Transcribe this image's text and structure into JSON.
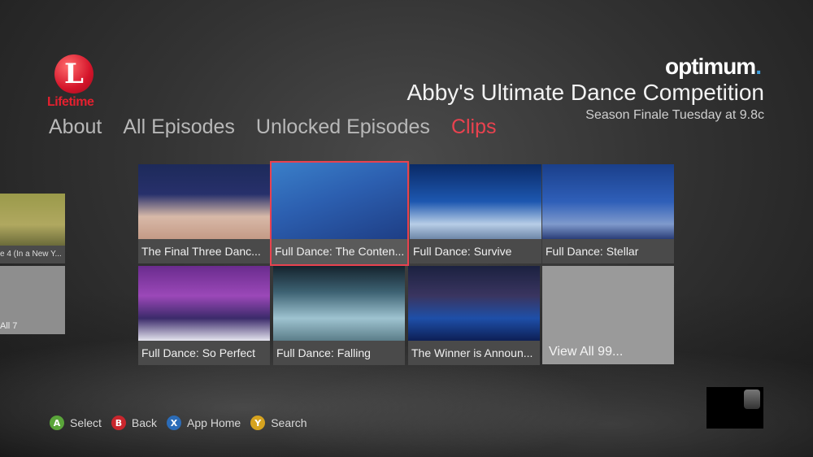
{
  "brand_logo": {
    "symbol": "L",
    "name": "Lifetime"
  },
  "nav": {
    "tabs": [
      {
        "label": "About",
        "active": false
      },
      {
        "label": "All Episodes",
        "active": false
      },
      {
        "label": "Unlocked Episodes",
        "active": false
      },
      {
        "label": "Clips",
        "active": true
      }
    ]
  },
  "header": {
    "provider": "optimum",
    "provider_dot": ".",
    "title": "Abby's Ultimate Dance Competition",
    "subtitle": "Season Finale Tuesday at 9.8c"
  },
  "left_partial": {
    "caption": "e 4 (In a New Y...",
    "view_all": "All 7"
  },
  "clips": [
    {
      "caption": "The Final Three Danc...",
      "selected": false
    },
    {
      "caption": "Full Dance: The Conten...",
      "selected": true
    },
    {
      "caption": "Full Dance: Survive",
      "selected": false
    },
    {
      "caption": "Full Dance: Stellar",
      "selected": false
    },
    {
      "caption": "Full Dance: So Perfect",
      "selected": false
    },
    {
      "caption": "Full Dance: Falling",
      "selected": false
    },
    {
      "caption": "The Winner is Announ...",
      "selected": false
    }
  ],
  "view_all": "View All 99...",
  "hints": [
    {
      "key": "A",
      "label": "Select",
      "color": "#5aa53a"
    },
    {
      "key": "B",
      "label": "Back",
      "color": "#c9262d"
    },
    {
      "key": "X",
      "label": "App Home",
      "color": "#2b6cb8"
    },
    {
      "key": "Y",
      "label": "Search",
      "color": "#d6a31f"
    }
  ],
  "colors": {
    "accent": "#e9424f",
    "lifetime_red": "#e4202f"
  }
}
